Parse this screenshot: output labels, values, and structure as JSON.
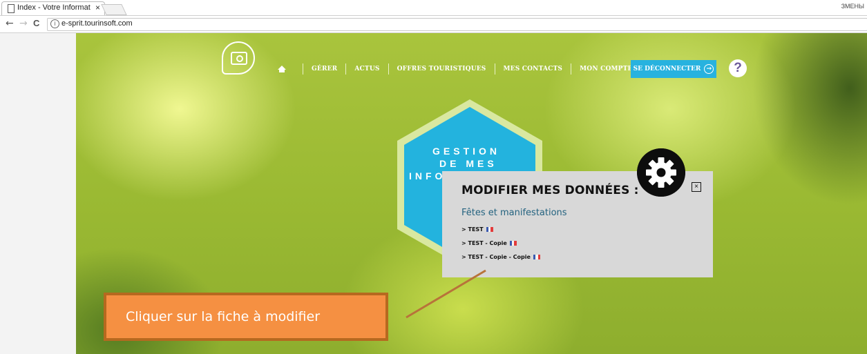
{
  "browser": {
    "tab_title": "Index - Votre Informatio",
    "tab_close": "×",
    "profile_label": "ЗМЕНЫ",
    "url": "e-sprit.tourinsoft.com",
    "nav_back": "←",
    "nav_forward": "→",
    "nav_reload": "C",
    "info_glyph": "i"
  },
  "site": {
    "nav_items": [
      "GÉRER",
      "ACTUS",
      "OFFRES TOURISTIQUES",
      "MES CONTACTS",
      "MON COMPTE"
    ],
    "logout_label": "SE DÉCONNECTER",
    "logout_arrow": "→",
    "help_label": "?",
    "hex_lines": [
      "GESTION",
      "DE MES",
      "INFO"
    ],
    "colors": {
      "accent": "#27b2df",
      "hex_fill": "#23b3de",
      "hex_border": "#d9e8a0"
    }
  },
  "popup": {
    "title": "MODIFIER MES DONNÉES :",
    "close_label": "×",
    "section_title": "Fêtes et manifestations",
    "items": [
      "> TEST",
      "> TEST - Copie",
      "> TEST - Copie - Copie"
    ]
  },
  "annotation": {
    "callout_text": "Cliquer sur la fiche à modifier",
    "color": "#f59042"
  }
}
